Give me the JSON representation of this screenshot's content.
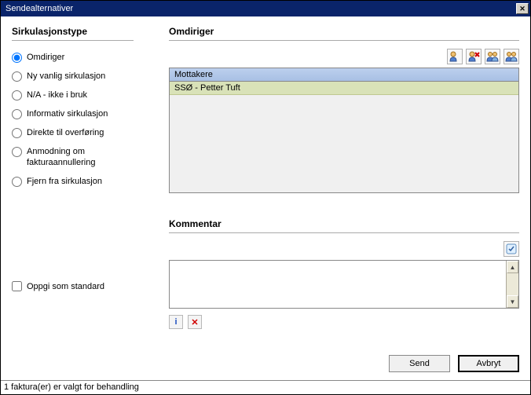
{
  "titlebar": {
    "title": "Sendealternativer"
  },
  "left": {
    "title": "Sirkulasjonstype",
    "options": [
      {
        "label": "Omdiriger",
        "checked": true
      },
      {
        "label": "Ny vanlig sirkulasjon",
        "checked": false
      },
      {
        "label": "N/A - ikke i bruk",
        "checked": false
      },
      {
        "label": "Informativ sirkulasjon",
        "checked": false
      },
      {
        "label": "Direkte til overføring",
        "checked": false
      },
      {
        "label": "Anmodning om fakturaannullering",
        "checked": false
      },
      {
        "label": "Fjern fra sirkulasjon",
        "checked": false
      }
    ],
    "default_checkbox": "Oppgi som standard"
  },
  "right": {
    "title": "Omdiriger",
    "list_header": "Mottakere",
    "list_rows": [
      "SSØ - Petter Tuft"
    ],
    "comment_title": "Kommentar"
  },
  "buttons": {
    "send": "Send",
    "cancel": "Avbryt"
  },
  "status": "1 faktura(er) er valgt for behandling"
}
